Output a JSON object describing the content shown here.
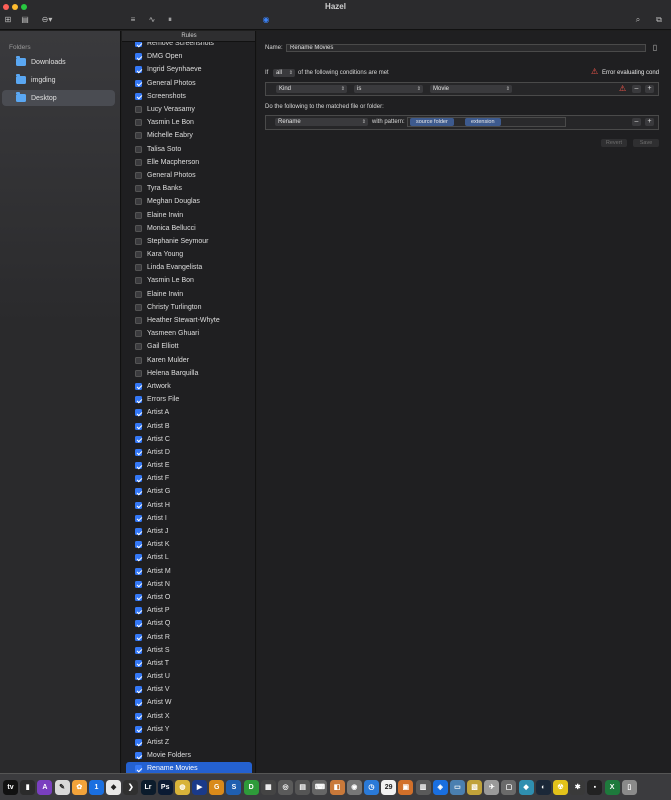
{
  "window": {
    "title": "Hazel"
  },
  "sidebar": {
    "header": "Folders",
    "items": [
      {
        "label": "Downloads",
        "selected": false
      },
      {
        "label": "imgding",
        "selected": false
      },
      {
        "label": "Desktop",
        "selected": true
      }
    ]
  },
  "rules": {
    "header": "Rules",
    "items": [
      {
        "label": "Remove Screenshots",
        "checked": true
      },
      {
        "label": "DMG Open",
        "checked": true
      },
      {
        "label": "Ingrid Seynhaeve",
        "checked": true
      },
      {
        "label": "General Photos",
        "checked": true
      },
      {
        "label": "Screenshots",
        "checked": true
      },
      {
        "label": "Lucy Verasamy",
        "checked": false
      },
      {
        "label": "Yasmin Le Bon",
        "checked": false
      },
      {
        "label": "Michelle Eabry",
        "checked": false
      },
      {
        "label": "Talisa Soto",
        "checked": false
      },
      {
        "label": "Elle Macpherson",
        "checked": false
      },
      {
        "label": "General Photos",
        "checked": false
      },
      {
        "label": "Tyra Banks",
        "checked": false
      },
      {
        "label": "Meghan Douglas",
        "checked": false
      },
      {
        "label": "Elaine Irwin",
        "checked": false
      },
      {
        "label": "Monica Bellucci",
        "checked": false
      },
      {
        "label": "Stephanie Seymour",
        "checked": false
      },
      {
        "label": "Kara Young",
        "checked": false
      },
      {
        "label": "Linda Evangelista",
        "checked": false
      },
      {
        "label": "Yasmin Le Bon",
        "checked": false
      },
      {
        "label": "Elaine Irwin",
        "checked": false
      },
      {
        "label": "Christy Turlington",
        "checked": false
      },
      {
        "label": "Heather Stewart-Whyte",
        "checked": false
      },
      {
        "label": "Yasmeen Ghuari",
        "checked": false
      },
      {
        "label": "Gail Elliott",
        "checked": false
      },
      {
        "label": "Karen Mulder",
        "checked": false
      },
      {
        "label": "Helena Barquilla",
        "checked": false
      },
      {
        "label": "Artwork",
        "checked": true
      },
      {
        "label": "Errors File",
        "checked": true
      },
      {
        "label": "Artist A",
        "checked": true
      },
      {
        "label": "Artist B",
        "checked": true
      },
      {
        "label": "Artist C",
        "checked": true
      },
      {
        "label": "Artist D",
        "checked": true
      },
      {
        "label": "Artist E",
        "checked": true
      },
      {
        "label": "Artist F",
        "checked": true
      },
      {
        "label": "Artist G",
        "checked": true
      },
      {
        "label": "Artist H",
        "checked": true
      },
      {
        "label": "Artist I",
        "checked": true
      },
      {
        "label": "Artist J",
        "checked": true
      },
      {
        "label": "Artist K",
        "checked": true
      },
      {
        "label": "Artist L",
        "checked": true
      },
      {
        "label": "Artist M",
        "checked": true
      },
      {
        "label": "Artist N",
        "checked": true
      },
      {
        "label": "Artist O",
        "checked": true
      },
      {
        "label": "Artist P",
        "checked": true
      },
      {
        "label": "Artist Q",
        "checked": true
      },
      {
        "label": "Artist R",
        "checked": true
      },
      {
        "label": "Artist S",
        "checked": true
      },
      {
        "label": "Artist T",
        "checked": true
      },
      {
        "label": "Artist U",
        "checked": true
      },
      {
        "label": "Artist V",
        "checked": true
      },
      {
        "label": "Artist W",
        "checked": true
      },
      {
        "label": "Artist X",
        "checked": true
      },
      {
        "label": "Artist Y",
        "checked": true
      },
      {
        "label": "Artist Z",
        "checked": true
      },
      {
        "label": "Movie Folders",
        "checked": true
      },
      {
        "label": "Rename Movies",
        "checked": true,
        "selected": true
      }
    ]
  },
  "editor": {
    "name_label": "Name:",
    "name_value": "Rename Movies",
    "if_label": "If",
    "match_value": "all",
    "conditions_text": "of the following conditions are met",
    "error_text": "Error evaluating cond",
    "condition": {
      "attribute": "Kind",
      "operator": "is",
      "value": "Movie"
    },
    "actions_header": "Do the following to the matched file or folder:",
    "action": {
      "type": "Rename",
      "with_label": "with pattern:",
      "tokens": [
        "source folder",
        "extension"
      ]
    },
    "revert_label": "Revert",
    "save_label": "Save",
    "remove_glyph": "–",
    "add_glyph": "+"
  },
  "dock": {
    "apps": [
      {
        "name": "apple-tv",
        "glyph": "tv",
        "color": "#111111"
      },
      {
        "name": "music-bars",
        "glyph": "▮",
        "color": "#2b2b2b"
      },
      {
        "name": "affinity",
        "glyph": "A",
        "color": "#7a3fbf"
      },
      {
        "name": "pencil-app",
        "glyph": "✎",
        "color": "#d9d9d9"
      },
      {
        "name": "photos",
        "glyph": "✿",
        "color": "#f2a33a"
      },
      {
        "name": "onepassword",
        "glyph": "1",
        "color": "#1a6fe0"
      },
      {
        "name": "finder-bag",
        "glyph": "◆",
        "color": "#e8e8e8"
      },
      {
        "name": "prompt",
        "glyph": "❯",
        "color": "#303030"
      },
      {
        "name": "lightroom",
        "glyph": "Lr",
        "color": "#0b1b2b"
      },
      {
        "name": "photoshop",
        "glyph": "Ps",
        "color": "#0b1b33"
      },
      {
        "name": "fruit",
        "glyph": "◍",
        "color": "#d8b33a"
      },
      {
        "name": "infuse",
        "glyph": "▶",
        "color": "#1a3a8a"
      },
      {
        "name": "g-app",
        "glyph": "G",
        "color": "#d98a1a"
      },
      {
        "name": "s-app",
        "glyph": "S",
        "color": "#1f5fb0"
      },
      {
        "name": "d-app",
        "glyph": "D",
        "color": "#2e9b3a"
      },
      {
        "name": "claquette",
        "glyph": "▦",
        "color": "#444444"
      },
      {
        "name": "screens",
        "glyph": "◎",
        "color": "#5a5a5a"
      },
      {
        "name": "board",
        "glyph": "▤",
        "color": "#555555"
      },
      {
        "name": "keys",
        "glyph": "⌨",
        "color": "#666666"
      },
      {
        "name": "stack",
        "glyph": "◧",
        "color": "#c9793a"
      },
      {
        "name": "disk",
        "glyph": "◉",
        "color": "#777777"
      },
      {
        "name": "safari",
        "glyph": "◷",
        "color": "#2a7ad8"
      },
      {
        "name": "calendar",
        "glyph": "29",
        "color": "#f1f1f1"
      },
      {
        "name": "cube",
        "glyph": "▣",
        "color": "#d2702a"
      },
      {
        "name": "files",
        "glyph": "▥",
        "color": "#5a5a5a"
      },
      {
        "name": "dropbox",
        "glyph": "◈",
        "color": "#1a6fe0"
      },
      {
        "name": "screen",
        "glyph": "▭",
        "color": "#4a7fb0"
      },
      {
        "name": "zip",
        "glyph": "▧",
        "color": "#c0a23a"
      },
      {
        "name": "bird",
        "glyph": "✈",
        "color": "#9a9a9a"
      },
      {
        "name": "window",
        "glyph": "▢",
        "color": "#6a6a6a"
      },
      {
        "name": "gem",
        "glyph": "◆",
        "color": "#2f8fb0"
      },
      {
        "name": "steam",
        "glyph": "◐",
        "color": "#1b2838"
      },
      {
        "name": "radiation",
        "glyph": "☢",
        "color": "#e3c21a"
      },
      {
        "name": "bug",
        "glyph": "✱",
        "color": "#3a3a3a"
      },
      {
        "name": "terminal",
        "glyph": "▪",
        "color": "#222222"
      },
      {
        "name": "excel",
        "glyph": "X",
        "color": "#1e7a3c"
      },
      {
        "name": "trash",
        "glyph": "▯",
        "color": "#8a8a8a"
      }
    ]
  }
}
